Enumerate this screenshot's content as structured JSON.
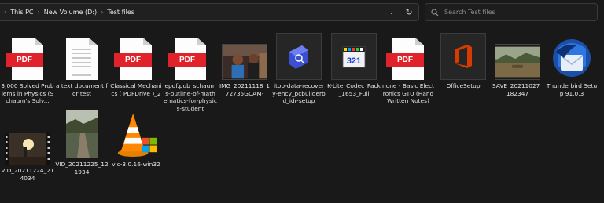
{
  "address_bar": {
    "breadcrumbs": [
      "This PC",
      "New Volume (D:)",
      "Test files"
    ]
  },
  "search": {
    "placeholder": "Search Test files"
  },
  "files": [
    {
      "name": "3,000 Solved Problems in Physics (Schaum's Solv...",
      "icon": "pdf-icon"
    },
    {
      "name": "a text document for test",
      "icon": "text-document-icon"
    },
    {
      "name": "Classical Mechanics ( PDFDrive )_2",
      "icon": "pdf-icon"
    },
    {
      "name": "epdf.pub_schaums-outline-of-mathematics-for-physics-student",
      "icon": "pdf-icon"
    },
    {
      "name": "IMG_20211118_172735GCAM-",
      "icon": "photo-thumbnail"
    },
    {
      "name": "itop-data-recovery-ency_pcbuilderbd_idr-setup",
      "icon": "installer-icon"
    },
    {
      "name": "K-Lite_Codec_Pack_1653_Full",
      "icon": "codec-installer-icon"
    },
    {
      "name": "none - Basic Electronics GTU (Hand Written Notes)",
      "icon": "pdf-icon"
    },
    {
      "name": "OfficeSetup",
      "icon": "office-icon"
    },
    {
      "name": "SAVE_20211027_182347",
      "icon": "photo-thumbnail"
    },
    {
      "name": "Thunderbird Setup 91.0.3",
      "icon": "thunderbird-icon"
    },
    {
      "name": "VID_20211224_214034",
      "icon": "video-thumbnail"
    },
    {
      "name": "VID_20211225_121934",
      "icon": "video-thumbnail"
    },
    {
      "name": "vlc-3.0.16-win32",
      "icon": "vlc-icon"
    }
  ],
  "colors": {
    "background": "#191919",
    "pdf_red": "#e0232b",
    "office_orange": "#d83b01"
  }
}
